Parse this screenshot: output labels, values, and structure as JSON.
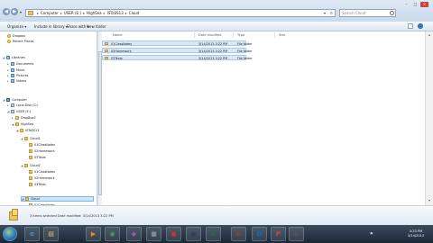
{
  "address": {
    "crumbs": [
      "Computer",
      "USER (E:)",
      "HighSea",
      "ISTaSS13",
      "Cloud"
    ],
    "separator": "▸"
  },
  "search": {
    "placeholder": "Search Cloud"
  },
  "toolbar": {
    "organize": "Organize ▾",
    "include": "Include in library ▾",
    "share": "Share with ▾",
    "new_folder": "New folder"
  },
  "nav": {
    "items": [
      {
        "label": "Dropbox",
        "icon": "star-icon"
      },
      {
        "label": "Recent Places",
        "icon": "star-icon"
      },
      {
        "label": "Libraries",
        "icon": "library-icon"
      },
      {
        "label": "Documents",
        "icon": "library-icon"
      },
      {
        "label": "Music",
        "icon": "library-icon"
      },
      {
        "label": "Pictures",
        "icon": "library-icon"
      },
      {
        "label": "Videos",
        "icon": "library-icon"
      },
      {
        "label": "Computer",
        "icon": "computer-icon"
      },
      {
        "label": "Local Disk (C:)",
        "icon": "drive-icon"
      },
      {
        "label": "USER (E:)",
        "icon": "drive-icon"
      },
      {
        "label": "DropBox2",
        "icon": "folder-icon"
      },
      {
        "label": "HighSea",
        "icon": "folder-icon"
      },
      {
        "label": "ISTaSS13",
        "icon": "folder-icon"
      },
      {
        "label": "Cloud1",
        "icon": "folder-icon"
      },
      {
        "label": "01ClassNotes",
        "icon": "folder-icon"
      },
      {
        "label": "02Homework",
        "icon": "folder-icon"
      },
      {
        "label": "03Tests",
        "icon": "folder-icon"
      },
      {
        "label": "Cloud2",
        "icon": "folder-icon"
      },
      {
        "label": "01ClassNotes",
        "icon": "folder-icon"
      },
      {
        "label": "02Homework",
        "icon": "folder-icon"
      },
      {
        "label": "03Tests",
        "icon": "folder-icon"
      },
      {
        "label": "Cloud",
        "icon": "folder-icon"
      },
      {
        "label": "01ClassNotes",
        "icon": "folder-icon"
      }
    ]
  },
  "columns": [
    "Name",
    "Date modified",
    "Type",
    "Size"
  ],
  "files": [
    {
      "name": "01ClassNotes",
      "date": "3/14/2013 3:22 PM",
      "type": "File folder",
      "size": ""
    },
    {
      "name": "02Homework",
      "date": "3/14/2013 3:22 PM",
      "type": "File folder",
      "size": ""
    },
    {
      "name": "03Tests",
      "date": "3/14/2013 3:22 PM",
      "type": "File folder",
      "size": ""
    }
  ],
  "details": {
    "text": "3 items selected  Date modified: 3/14/2013 3:22 PM"
  },
  "taskbar": {
    "apps": [
      {
        "name": "ie-icon",
        "glyph": "e",
        "color": "#3d8fe0"
      },
      {
        "name": "explorer-icon",
        "glyph": "▤",
        "color": "#e9c46a"
      },
      {
        "name": "media-icon",
        "glyph": "▶",
        "color": "#f08a24"
      },
      {
        "name": "chrome-icon",
        "glyph": "◉",
        "color": "#3aa757"
      },
      {
        "name": "app5-icon",
        "glyph": "◆",
        "color": "#9b59b6"
      },
      {
        "name": "app6-icon",
        "glyph": "■",
        "color": "#7f8c8d"
      },
      {
        "name": "app7-icon",
        "glyph": "●",
        "color": "#c0392b"
      },
      {
        "name": "app8-icon",
        "glyph": "▣",
        "color": "#2c3e50"
      },
      {
        "name": "excel-icon",
        "glyph": "X",
        "color": "#1e7145"
      },
      {
        "name": "access-icon",
        "glyph": "A",
        "color": "#a4373a"
      },
      {
        "name": "outlook-icon",
        "glyph": "O",
        "color": "#0072c6"
      },
      {
        "name": "powerpoint-icon",
        "glyph": "P",
        "color": "#d24726"
      },
      {
        "name": "app13-icon",
        "glyph": "▦",
        "color": "#555"
      }
    ],
    "clock_time": "3:23 PM",
    "clock_date": "3/14/2013"
  }
}
